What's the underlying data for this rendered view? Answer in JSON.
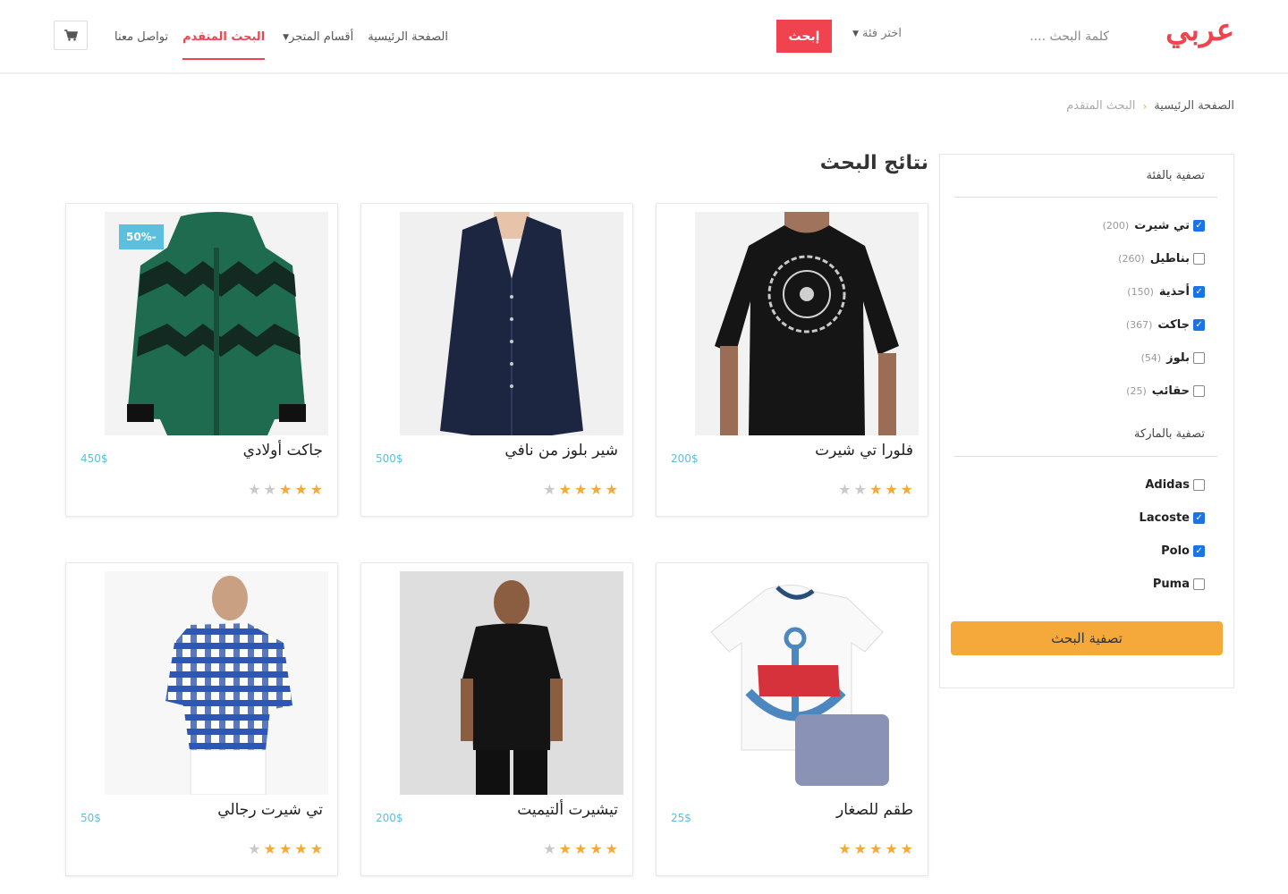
{
  "header": {
    "logo": "عربي",
    "search_placeholder": "كلمة البحث ....",
    "category_select": "اختر فئة",
    "search_button": "إبحث",
    "nav": {
      "home": "الصفحة الرئيسية",
      "store_sections": "أقسام المتجر",
      "advanced_search": "البحث المتقدم",
      "contact": "تواصل معنا"
    }
  },
  "breadcrumb": {
    "home": "الصفحة الرئيسية",
    "current": "البحث المتقدم"
  },
  "sidebar": {
    "category_title": "تصفية بالفئة",
    "categories": [
      {
        "label": "تي شيرت",
        "count": "(200)",
        "checked": true
      },
      {
        "label": "بناطيل",
        "count": "(260)",
        "checked": false
      },
      {
        "label": "أحذية",
        "count": "(150)",
        "checked": true
      },
      {
        "label": "جاكت",
        "count": "(367)",
        "checked": true
      },
      {
        "label": "بلوز",
        "count": "(54)",
        "checked": false
      },
      {
        "label": "حقائب",
        "count": "(25)",
        "checked": false
      }
    ],
    "brand_title": "تصفية بالماركة",
    "brands": [
      {
        "label": "Adidas",
        "checked": false
      },
      {
        "label": "Lacoste",
        "checked": true
      },
      {
        "label": "Polo",
        "checked": true
      },
      {
        "label": "Puma",
        "checked": false
      }
    ],
    "filter_button": "تصفية البحث"
  },
  "results": {
    "title": "نتائج البحث",
    "products": [
      {
        "name": "فلورا تي شيرت",
        "price": "200$",
        "rating": 3,
        "image": "black-tshirt",
        "discount": ""
      },
      {
        "name": "شير بلوز من نافي",
        "price": "500$",
        "rating": 4,
        "image": "navy-blouse",
        "discount": ""
      },
      {
        "name": "جاكت أولادي",
        "price": "450$",
        "rating": 3,
        "image": "green-jacket",
        "discount": "50%-"
      },
      {
        "name": "طقم للصغار",
        "price": "25$",
        "rating": 5,
        "image": "kids-set",
        "discount": ""
      },
      {
        "name": "تيشيرت ألتيميت",
        "price": "200$",
        "rating": 4,
        "image": "black-athletic-tee",
        "discount": ""
      },
      {
        "name": "تي شيرت رجالي",
        "price": "50$",
        "rating": 4,
        "image": "plaid-shirt",
        "discount": ""
      }
    ]
  },
  "colors": {
    "brand_red": "#f0434f",
    "accent_orange": "#f6a93b",
    "price_blue": "#5bc0de",
    "checkbox_blue": "#1a73e8"
  },
  "icons": {
    "cart": "shopping-cart-icon",
    "star": "star-icon"
  }
}
